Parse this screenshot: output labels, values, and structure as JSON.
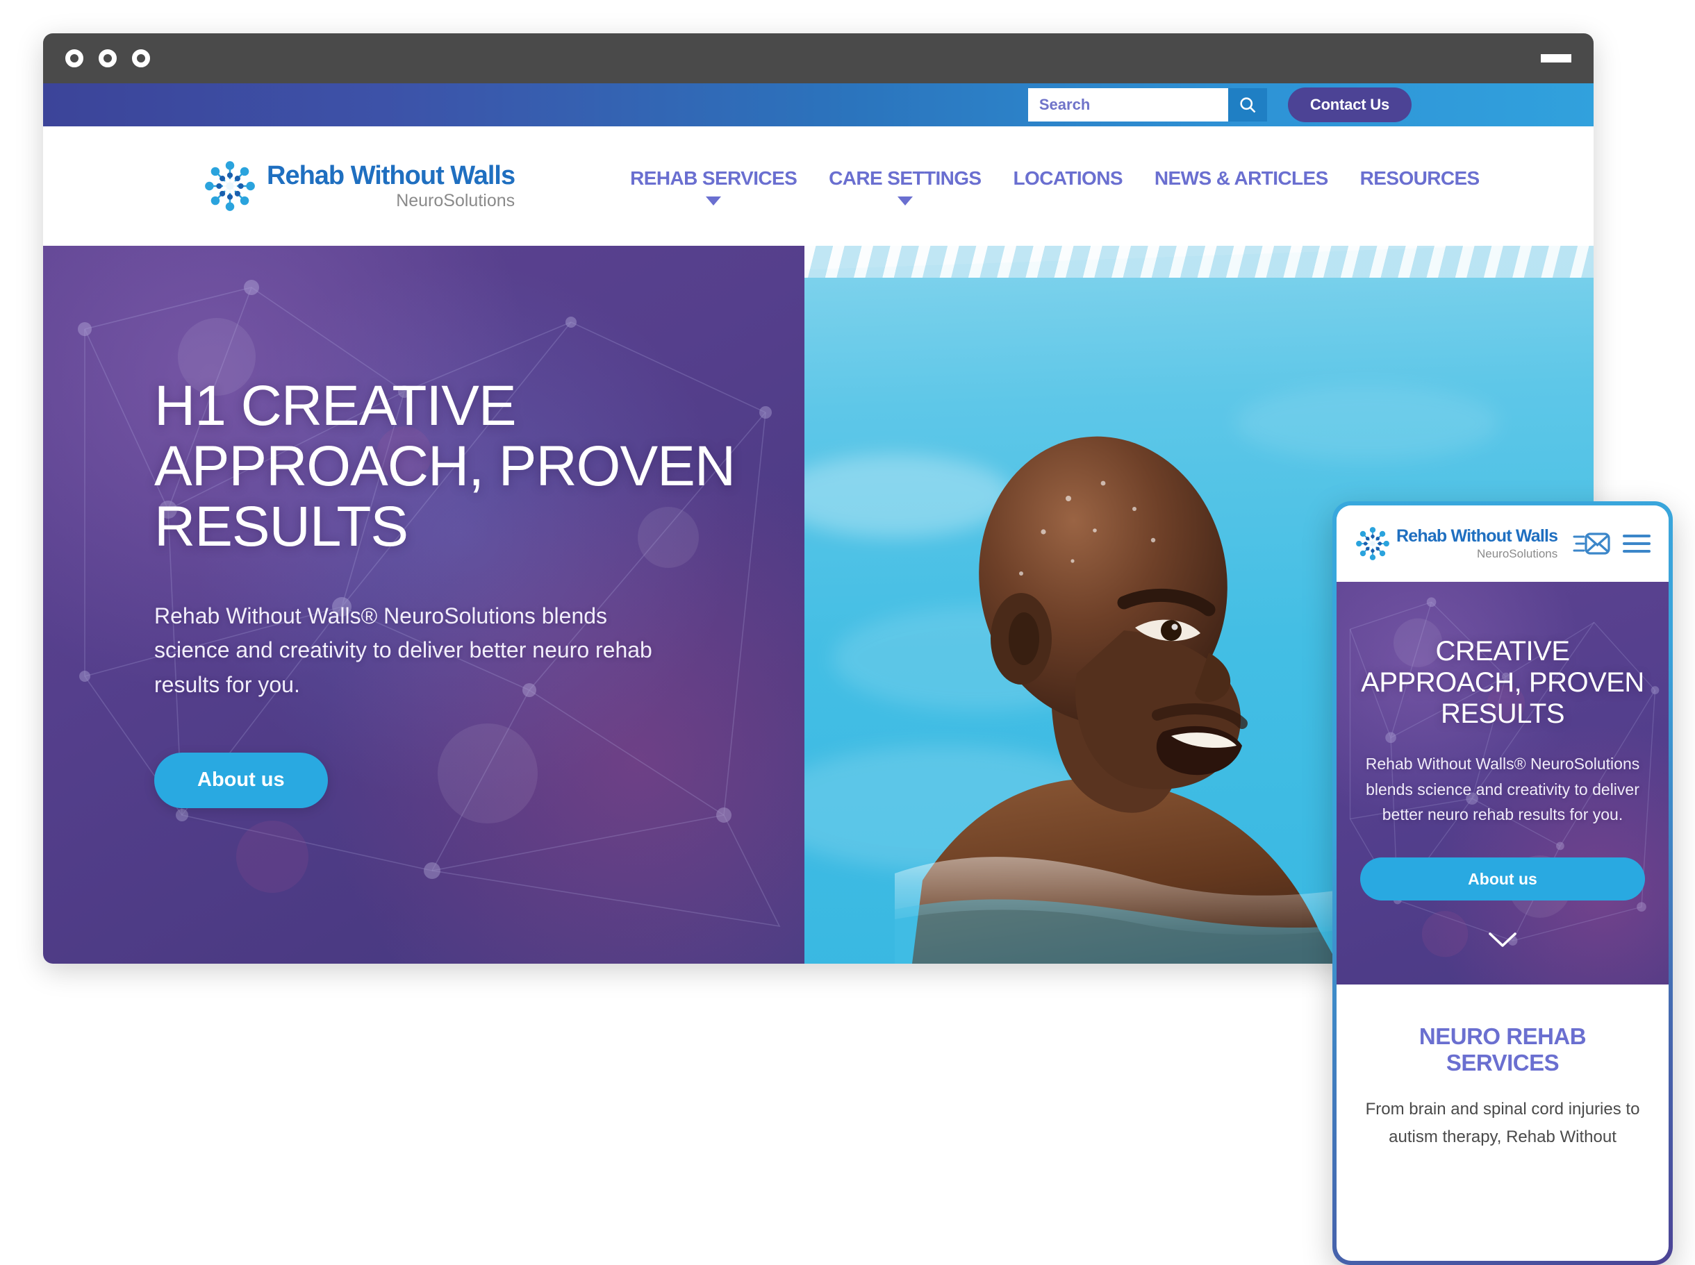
{
  "window": {
    "traffic_lights": [
      "close",
      "minimize",
      "maximize"
    ],
    "minimize_label": "",
    "chrome_color": "#4a4a4a"
  },
  "colors": {
    "brand_blue": "#1f6fc0",
    "accent_cyan": "#29a9e1",
    "nav_purple": "#6a6fd0",
    "contact_purple": "#4c4395",
    "hero_purple": "#5d4391"
  },
  "utility_bar": {
    "search": {
      "placeholder": "Search",
      "value": "",
      "button_icon": "search-icon"
    },
    "contact_label": "Contact Us"
  },
  "brand": {
    "title": "Rehab Without Walls",
    "subtitle": "NeuroSolutions",
    "mark": "neuron-starburst-icon"
  },
  "nav": {
    "items": [
      {
        "label": "REHAB SERVICES",
        "has_dropdown": true
      },
      {
        "label": "CARE SETTINGS",
        "has_dropdown": true
      },
      {
        "label": "LOCATIONS",
        "has_dropdown": false
      },
      {
        "label": "NEWS & ARTICLES",
        "has_dropdown": false
      },
      {
        "label": "RESOURCES",
        "has_dropdown": false
      }
    ]
  },
  "hero": {
    "heading": "H1 CREATIVE APPROACH, PROVEN RESULTS",
    "body": "Rehab Without Walls® NeuroSolutions blends science and creativity to deliver better neuro rehab results for you.",
    "cta_label": "About us",
    "image_alt": "man swimming in a pool"
  },
  "mobile": {
    "header": {
      "contact_icon": "envelope-icon",
      "menu_icon": "hamburger-menu-icon"
    },
    "hero": {
      "heading": "CREATIVE APPROACH, PROVEN RESULTS",
      "body": "Rehab Without Walls® NeuroSolutions blends science and creativity to deliver better neuro rehab results for you.",
      "cta_label": "About us",
      "scroll_icon": "chevron-down-icon"
    },
    "services": {
      "title": "NEURO REHAB SERVICES",
      "body": "From brain and spinal cord injuries to autism therapy, Rehab Without"
    }
  }
}
